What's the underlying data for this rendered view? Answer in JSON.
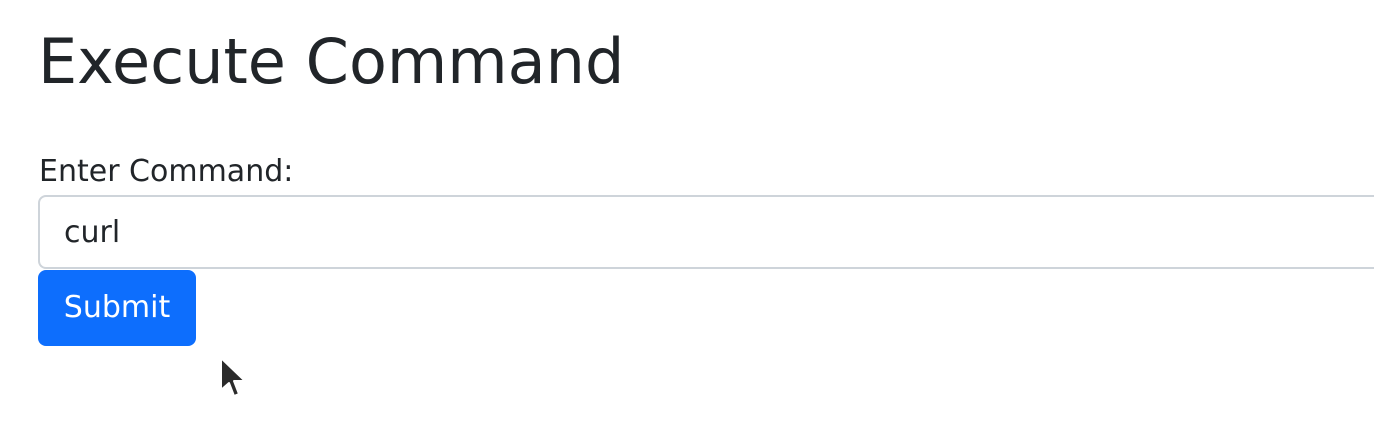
{
  "page": {
    "title": "Execute Command"
  },
  "form": {
    "label": "Enter Command:",
    "input_value": "curl",
    "submit_label": "Submit"
  },
  "colors": {
    "primary": "#0d6efd",
    "text": "#212529",
    "input_border": "#ced4da"
  },
  "icons": {
    "cursor": "mouse-pointer-icon"
  }
}
